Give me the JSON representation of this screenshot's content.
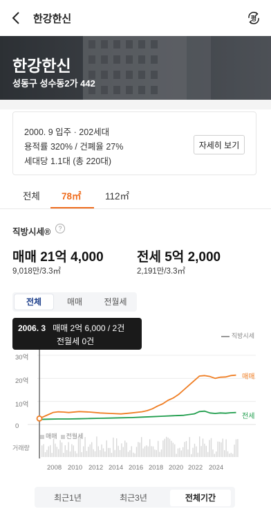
{
  "header": {
    "title": "한강한신",
    "back_icon": "back-arrow-icon",
    "pyeong_icon": "pyeong-toggle-icon",
    "pyeong_label": "평"
  },
  "hero": {
    "name": "한강한신",
    "address": "성동구 성수동2가 442"
  },
  "info": {
    "line1": "2000. 9 입주 · 202세대",
    "line2": "용적률 320% / 건폐율 27%",
    "line3": "세대당 1.1대 (총 220대)",
    "detail_button": "자세히 보기"
  },
  "area_tabs": [
    {
      "label": "전체",
      "active": false
    },
    {
      "label": "78㎡",
      "active": true
    },
    {
      "label": "112㎡",
      "active": false
    }
  ],
  "market": {
    "section_label": "직방시세®",
    "help_icon": "help-icon",
    "help_glyph": "?",
    "sale_label": "매매 21억 4,000",
    "sale_per_area": "9,018만/3.3㎡",
    "jeonse_label": "전세 5억 2,000",
    "jeonse_per_area": "2,191만/3.3㎡"
  },
  "trade_tabs": [
    {
      "label": "전체",
      "active": true
    },
    {
      "label": "매매",
      "active": false
    },
    {
      "label": "전월세",
      "active": false
    }
  ],
  "tooltip": {
    "date": "2006. 3",
    "sale_text": "매매 2억 6,000 / 2건",
    "rent_text": "전월세 0건"
  },
  "legend": {
    "zigbang_price": "직방시세",
    "sale": "매매",
    "rent": "전월세",
    "volume_label": "거래량"
  },
  "colors": {
    "accent": "#ef6c1d",
    "sale_line": "#ef7d22",
    "jeonse_line": "#1f9d4c",
    "active_tab_text": "#1c3e8a"
  },
  "chart_data": {
    "type": "line",
    "xlabel": "",
    "ylabel": "",
    "y_ticks": [
      "30억",
      "20억",
      "10억",
      "0"
    ],
    "ylim": [
      0,
      30
    ],
    "x_ticks": [
      "2008",
      "2010",
      "2012",
      "2014",
      "2016",
      "2018",
      "2020",
      "2022",
      "2024"
    ],
    "xlim": [
      2006.0,
      2025.3
    ],
    "series": [
      {
        "name": "매매",
        "x": [
          2006.2,
          2007.0,
          2007.5,
          2008.0,
          2008.5,
          2009.0,
          2010.0,
          2011.0,
          2012.0,
          2013.0,
          2014.0,
          2015.0,
          2016.0,
          2016.5,
          2017.0,
          2017.5,
          2018.0,
          2018.5,
          2019.0,
          2019.5,
          2020.0,
          2020.5,
          2021.0,
          2021.5,
          2022.0,
          2022.5,
          2023.0,
          2023.5,
          2024.0,
          2024.5,
          2025.0
        ],
        "values": [
          2.6,
          4.2,
          5.2,
          5.5,
          5.4,
          5.2,
          5.6,
          5.4,
          5.0,
          4.8,
          4.6,
          5.0,
          5.5,
          6.0,
          6.8,
          8.0,
          9.0,
          10.5,
          11.5,
          13.0,
          15.0,
          17.0,
          19.0,
          21.0,
          21.2,
          20.8,
          20.0,
          20.5,
          20.6,
          21.2,
          21.4
        ]
      },
      {
        "name": "전세",
        "x": [
          2006.2,
          2007.0,
          2008.0,
          2009.0,
          2010.0,
          2011.0,
          2012.0,
          2013.0,
          2014.0,
          2015.0,
          2016.0,
          2017.0,
          2018.0,
          2019.0,
          2020.0,
          2021.0,
          2021.5,
          2022.0,
          2022.5,
          2023.0,
          2023.5,
          2024.0,
          2024.5,
          2025.0
        ],
        "values": [
          2.2,
          2.3,
          2.4,
          2.4,
          2.5,
          2.6,
          2.7,
          2.8,
          2.9,
          3.0,
          3.2,
          3.4,
          3.6,
          3.8,
          4.0,
          4.6,
          5.6,
          5.8,
          5.0,
          4.8,
          5.0,
          4.9,
          5.1,
          5.2
        ]
      }
    ],
    "series_labels": [
      "매매",
      "전세"
    ]
  },
  "range_tabs": [
    {
      "label": "최근1년",
      "active": false
    },
    {
      "label": "최근3년",
      "active": false
    },
    {
      "label": "전체기간",
      "active": true
    }
  ]
}
